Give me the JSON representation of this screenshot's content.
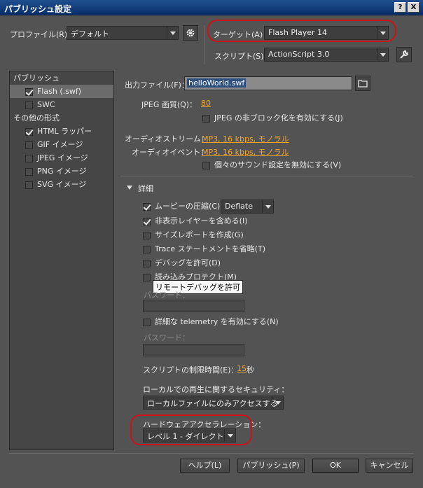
{
  "window": {
    "title": "パブリッシュ設定",
    "help_glyph": "?",
    "close_glyph": "X"
  },
  "top": {
    "profile_label": "プロファイル(R)：",
    "profile_label_key": "R",
    "profile_value": "デフォルト",
    "target_label": "ターゲット(A)：",
    "target_value": "Flash Player 14",
    "script_label": "スクリプト(S)：",
    "script_value": "ActionScript 3.0"
  },
  "sidebar": {
    "publish_header": "パブリッシュ",
    "items_publish": [
      {
        "label": "Flash (.swf)",
        "checked": true,
        "selected": true
      },
      {
        "label": "SWC",
        "checked": false,
        "selected": false
      }
    ],
    "other_header": "その他の形式",
    "items_other": [
      {
        "label": "HTML ラッパー",
        "checked": true
      },
      {
        "label": "GIF イメージ",
        "checked": false
      },
      {
        "label": "JPEG イメージ",
        "checked": false
      },
      {
        "label": "PNG イメージ",
        "checked": false
      },
      {
        "label": "SVG イメージ",
        "checked": false
      }
    ]
  },
  "main": {
    "output_file_label": "出力ファイル(F)：",
    "output_file_value": "helloWorld.swf",
    "jpeg_quality_label": "JPEG 画質(Q)：",
    "jpeg_quality_value": "80",
    "jpeg_deblock_label": "JPEG の非ブロック化を有効にする(J)",
    "audio_stream_label": "オーディオストリーム：",
    "audio_stream_value": "MP3, 16 kbps, モノラル",
    "audio_event_label": "オーディオイベント：",
    "audio_event_value": "MP3, 16 kbps, モノラル",
    "override_sound_label": "個々のサウンド設定を無効にする(V)",
    "details_label": "詳細",
    "compress_label": "ムービーの圧縮(C)",
    "compress_value": "Deflate",
    "include_hidden_label": "非表示レイヤーを含める(I)",
    "size_report_label": "サイズレポートを作成(G)",
    "omit_trace_label": "Trace ステートメントを省略(T)",
    "permit_debug_label": "デバッグを許可(D)",
    "protect_import_label": "読み込みプロテクト(M)",
    "password_label_1": "パスワード：",
    "tooltip": "リモートデバッグを許可",
    "telemetry_label": "詳細な telemetry を有効にする(N)",
    "password_label_2": "パスワード：",
    "script_time_label": "スクリプトの制限時間(E)：",
    "script_time_value": "15",
    "script_time_unit": "秒",
    "local_security_label": "ローカルでの再生に関するセキュリティ：",
    "local_security_value": "ローカルファイルにのみアクセスする",
    "hw_accel_label": "ハードウェアアクセラレーション：",
    "hw_accel_value": "レベル 1 - ダイレクト"
  },
  "buttons": {
    "help": "ヘルプ(L)",
    "publish": "パブリッシュ(P)",
    "ok": "OK",
    "cancel": "キャンセル"
  },
  "colors": {
    "accent_link": "#f1a52c",
    "annotation_ring": "#cc1418",
    "background": "#535353"
  },
  "icons": {
    "profile_settings": "gear-icon",
    "output_browse": "folder-icon",
    "script_settings": "wrench-icon",
    "details_toggle": "triangle-down-icon"
  }
}
